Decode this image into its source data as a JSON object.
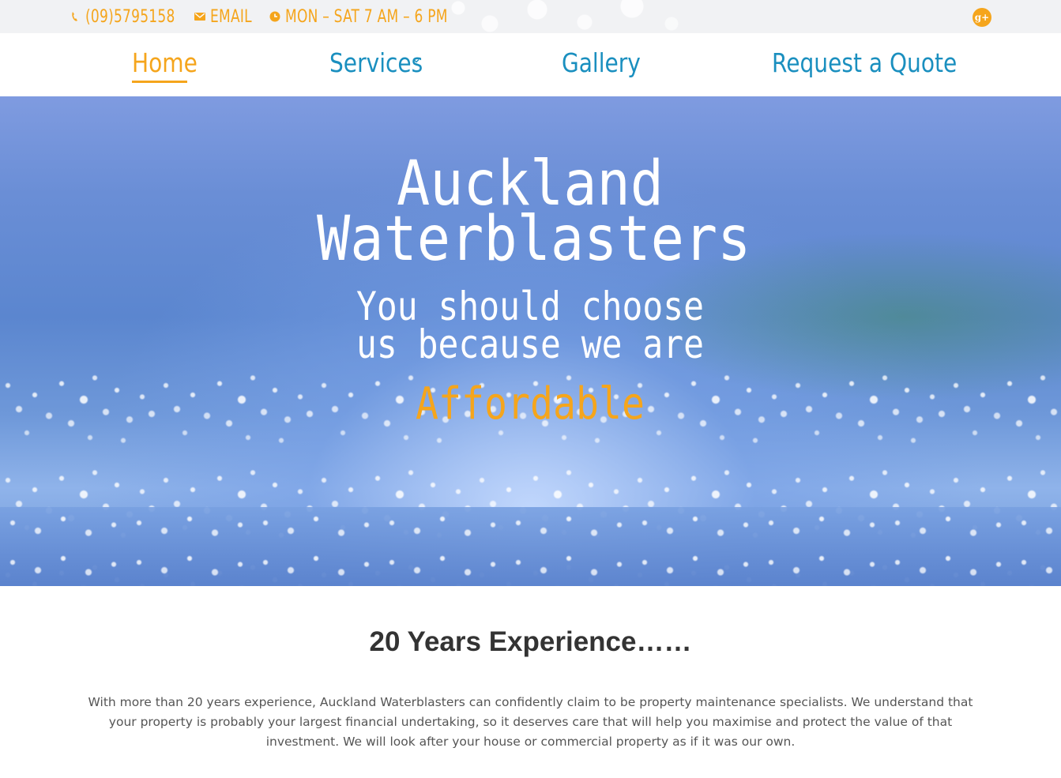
{
  "topbar": {
    "phone": "(09)5795158",
    "email_label": "EMAIL",
    "hours": "MON – SAT 7 AM – 6 PM",
    "icons": {
      "phone": "phone-icon",
      "email": "envelope-icon",
      "hours": "clock-icon",
      "social": "google-plus-icon"
    },
    "social_glyph": "g+"
  },
  "nav": {
    "items": [
      {
        "label": "Home",
        "active": true
      },
      {
        "label": "Services",
        "has_dropdown": true
      },
      {
        "label": "Gallery"
      },
      {
        "label": "Request a Quote"
      }
    ]
  },
  "hero": {
    "title": "Auckland Waterblasters",
    "subtitle": "You should choose us because we are",
    "rotating_word": "Affordable"
  },
  "intro": {
    "heading": "20 Years Experience……",
    "body": "With more than 20 years experience, Auckland Waterblasters can confidently claim to be property maintenance specialists. We understand that your property is probably your largest financial undertaking, so it deserves care that will help you maximise and protect the value of that investment. We will look after your house or commercial property as if it was our own."
  },
  "colors": {
    "accent": "#f5a51c",
    "nav_link": "#1a8fbf",
    "heading": "#333333",
    "body_text": "#555555"
  }
}
